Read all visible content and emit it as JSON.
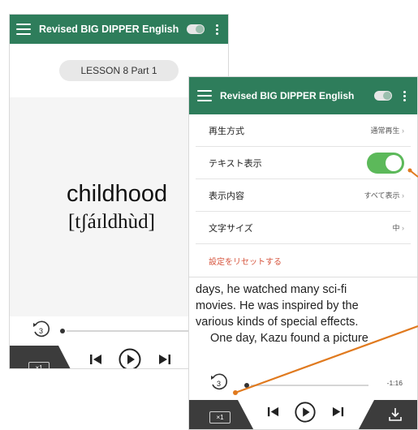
{
  "left_phone": {
    "appbar": {
      "title": "Revised BIG DIPPER English"
    },
    "lesson_label": "LESSON 8 Part 1",
    "word": "childhood",
    "ipa": "[tʃáɪldhùd]",
    "replay_count": "3",
    "speed": "×1"
  },
  "right_phone": {
    "appbar": {
      "title": "Revised BIG DIPPER English"
    },
    "settings": {
      "playback": {
        "label": "再生方式",
        "value": "通常再生"
      },
      "text_display": {
        "label": "テキスト表示",
        "on": true
      },
      "display_content": {
        "label": "表示内容",
        "value": "すべて表示"
      },
      "font_size": {
        "label": "文字サイズ",
        "value": "中"
      },
      "reset_label": "設定をリセットする"
    },
    "reading_lines": [
      "days, he watched many sci-fi",
      "movies.   He was inspired by the",
      "various kinds of special effects.",
      "One day, Kazu found a picture"
    ],
    "replay_count": "3",
    "time": "-1:16",
    "speed": "×1"
  },
  "colors": {
    "appbar": "#2e7d5b",
    "switch_on": "#5cb95a",
    "callout": "#e07a1f",
    "reset_text": "#d6553e"
  }
}
